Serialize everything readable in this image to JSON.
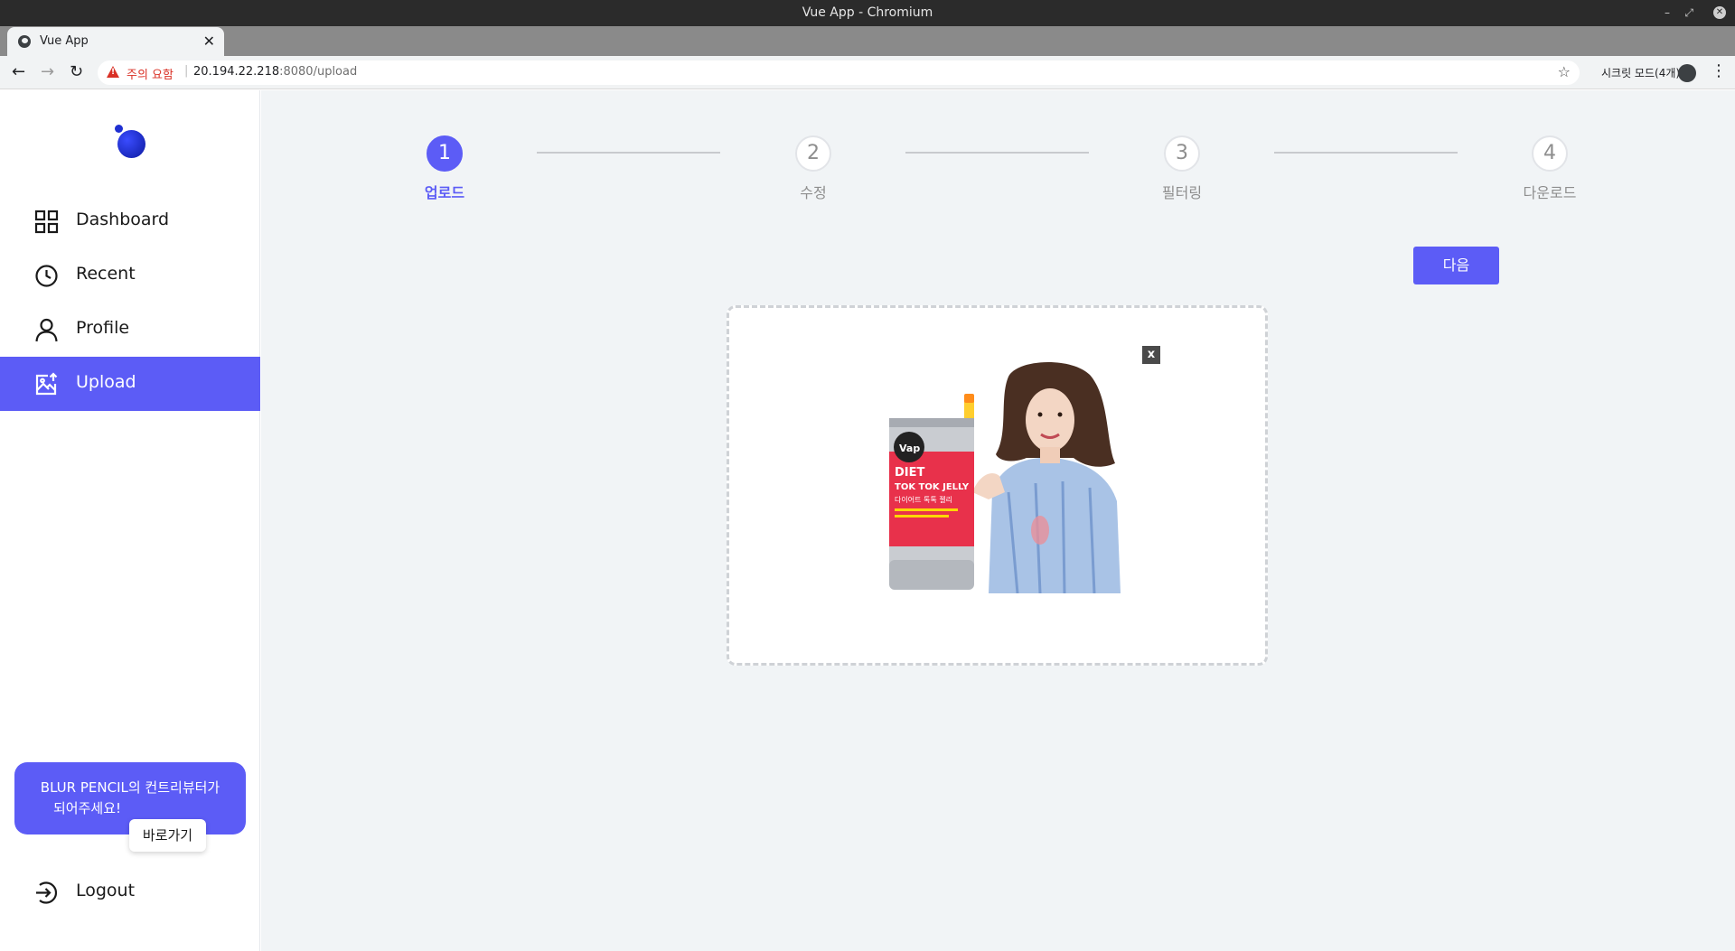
{
  "browser": {
    "window_title": "Vue App - Chromium",
    "tab_title": "Vue App",
    "tab_close": "✕",
    "new_tab": "+",
    "security_warning": "주의 요함",
    "url_host": "20.194.22.218",
    "url_rest": ":8080/upload",
    "incognito_label": "시크릿 모드(4개)",
    "window_min": "–",
    "window_max": "⤢",
    "window_close": "✕"
  },
  "sidebar": {
    "items": [
      {
        "label": "Dashboard",
        "icon": "grid-icon"
      },
      {
        "label": "Recent",
        "icon": "clock-icon"
      },
      {
        "label": "Profile",
        "icon": "user-icon"
      },
      {
        "label": "Upload",
        "icon": "image-upload-icon",
        "active": true
      }
    ],
    "cta_text_line1": "BLUR PENCIL의 컨트리뷰터가",
    "cta_text_line2": "되어주세요!",
    "cta_button": "바로가기",
    "logout_label": "Logout",
    "logout_icon": "logout-icon"
  },
  "stepper": {
    "steps": [
      {
        "number": "1",
        "label": "업로드",
        "active": true
      },
      {
        "number": "2",
        "label": "수정",
        "active": false
      },
      {
        "number": "3",
        "label": "필터링",
        "active": false
      },
      {
        "number": "4",
        "label": "다운로드",
        "active": false
      }
    ]
  },
  "actions": {
    "next_label": "다음"
  },
  "upload": {
    "remove_label": "x",
    "image_texts": {
      "brand": "Vap",
      "product_line1": "DIET",
      "product_line2": "TOK TOK JELLY",
      "product_korean": "다이어트 톡톡 젤리"
    }
  },
  "colors": {
    "accent": "#5c5cf6",
    "main_bg": "#f1f4f6",
    "warning": "#d93025"
  }
}
